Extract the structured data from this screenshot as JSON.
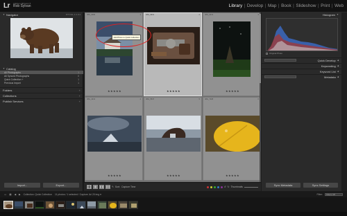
{
  "app": {
    "logo": "Lr",
    "identity_line1": "Adobe Lightroom 5",
    "identity_name": "Rob Sylvan"
  },
  "modules": [
    "Library",
    "Develop",
    "Map",
    "Book",
    "Slideshow",
    "Print",
    "Web"
  ],
  "active_module": "Library",
  "left_panel": {
    "navigator_title": "Navigator",
    "navigator_zoom": "FIT FILL 1:1 3:1",
    "catalog_title": "Catalog",
    "catalog_items": [
      {
        "label": "All Photographs",
        "count": "1"
      },
      {
        "label": "All Synced Photographs",
        "count": "0"
      },
      {
        "label": "Quick Collection +",
        "count": "1"
      },
      {
        "label": "Previous Import",
        "count": "1"
      }
    ],
    "sections": [
      "Folders",
      "Collections",
      "Publish Services"
    ],
    "import_label": "Import...",
    "export_label": "Export..."
  },
  "grid": {
    "cells": [
      {
        "meta1": "IMG_6096",
        "meta2": "1624 x 2436",
        "num": "1",
        "stars": "★★★★★"
      },
      {
        "meta1": "IMG_9931",
        "meta2": "2048 x 1365",
        "num": "2",
        "stars": "★★★★★"
      },
      {
        "meta1": "IMG_0213",
        "meta2": "1633 x 2449",
        "num": "3",
        "stars": "★★★★★"
      },
      {
        "meta1": "IMG_4213",
        "meta2": "4102 x 2735",
        "num": "4",
        "stars": "★★★★★"
      },
      {
        "meta1": "IMG_5547",
        "meta2": "3216 x 2140",
        "num": "5",
        "stars": "★★★★★"
      },
      {
        "meta1": "IMG_7208",
        "meta2": "3072 x 2304",
        "num": "6",
        "stars": "★★★★★"
      }
    ],
    "tooltip": "Add Photo to Quick Collection"
  },
  "toolbar": {
    "sort_label": "Sort:",
    "sort_value": "Capture Time",
    "thumbnails_label": "Thumbnails"
  },
  "label_colors": [
    "#c33",
    "#cc3",
    "#3a3",
    "#37c",
    "#839"
  ],
  "right_panel": {
    "histogram_title": "Histogram",
    "original_photo": "Original Photo",
    "rows": [
      {
        "left": "Default",
        "label": "Quick Develop"
      },
      {
        "left": "",
        "label": "Keywording"
      },
      {
        "left": "",
        "label": "Keyword List"
      },
      {
        "left": "Default",
        "label": "Metadata"
      }
    ],
    "sync_label": "Sync Metadata",
    "sync_settings_label": "Sync Settings"
  },
  "filmstrip": {
    "source": "Collection: Quick Collection",
    "info": "11 photos / 1 selected / Capture Jul 20 img ▾",
    "filter_label": "Filter:",
    "filter_value": "Filters Off"
  }
}
